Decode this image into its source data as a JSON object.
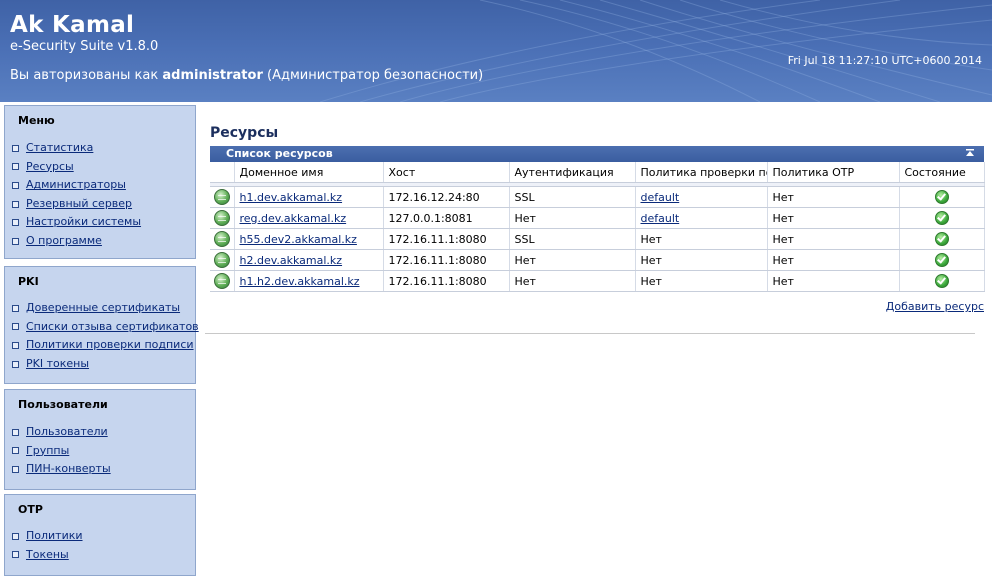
{
  "header": {
    "brand": "Ak Kamal",
    "subtitle": "e-Security Suite v1.8.0",
    "auth_prefix": "Вы авторизованы как ",
    "auth_user": "administrator",
    "auth_role": " (Администратор безопасности)",
    "datetime": "Fri Jul 18 11:27:10 UTC+0600 2014"
  },
  "sidebar": {
    "menu": {
      "title": "Меню",
      "items": [
        "Статистика",
        "Ресурсы",
        "Администраторы",
        "Резервный сервер",
        "Настройки системы",
        "О программе"
      ]
    },
    "pki": {
      "title": "PKI",
      "items": [
        "Доверенные сертификаты",
        "Списки отзыва сертификатов",
        "Политики проверки подписи",
        "PKI токены"
      ]
    },
    "users": {
      "title": "Пользователи",
      "items": [
        "Пользователи",
        "Группы",
        "ПИН-конверты"
      ]
    },
    "otp": {
      "title": "OTP",
      "items": [
        "Политики",
        "Токены"
      ]
    }
  },
  "main": {
    "title": "Ресурсы",
    "list_title": "Список ресурсов",
    "columns": [
      "Доменное имя",
      "Хост",
      "Аутентификация",
      "Политика проверки по",
      "Политика OTP",
      "Состояние"
    ],
    "rows": [
      {
        "domain": "h1.dev.akkamal.kz",
        "host": "172.16.12.24:80",
        "auth": "SSL",
        "policy": "default",
        "policy_link": true,
        "otp": "Нет",
        "state": "ok"
      },
      {
        "domain": "reg.dev.akkamal.kz",
        "host": "127.0.0.1:8081",
        "auth": "Нет",
        "policy": "default",
        "policy_link": true,
        "otp": "Нет",
        "state": "ok"
      },
      {
        "domain": "h55.dev2.akkamal.kz",
        "host": "172.16.11.1:8080",
        "auth": "SSL",
        "policy": "Нет",
        "policy_link": false,
        "otp": "Нет",
        "state": "ok"
      },
      {
        "domain": "h2.dev.akkamal.kz",
        "host": "172.16.11.1:8080",
        "auth": "Нет",
        "policy": "Нет",
        "policy_link": false,
        "otp": "Нет",
        "state": "ok"
      },
      {
        "domain": "h1.h2.dev.akkamal.kz",
        "host": "172.16.11.1:8080",
        "auth": "Нет",
        "policy": "Нет",
        "policy_link": false,
        "otp": "Нет",
        "state": "ok"
      }
    ],
    "add_link": "Добавить ресурс"
  }
}
